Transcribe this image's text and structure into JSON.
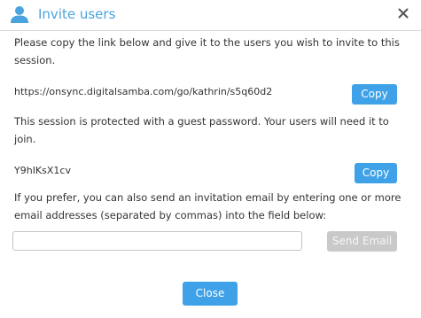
{
  "header": {
    "title": "Invite users",
    "icon": "user-icon",
    "close_icon": "close-icon"
  },
  "link_section": {
    "instructions": "Please copy the link below and give it to the users you wish to invite to this session.",
    "link": "https://onsync.digitalsamba.com/go/kathrin/s5q60d2",
    "copy_label": "Copy"
  },
  "password_section": {
    "instructions": "This session is protected with a guest password. Your users will need it to join.",
    "password": "Y9hIKsX1cv",
    "copy_label": "Copy"
  },
  "email_section": {
    "instructions": "If you prefer, you can also send an invitation email by entering one or more email addresses (separated by commas) into the field below:",
    "input_value": "",
    "send_label": "Send Email"
  },
  "footer": {
    "close_label": "Close"
  },
  "colors": {
    "accent": "#3fa2e8",
    "title": "#4aa3df",
    "disabled": "#c9c9c9"
  }
}
